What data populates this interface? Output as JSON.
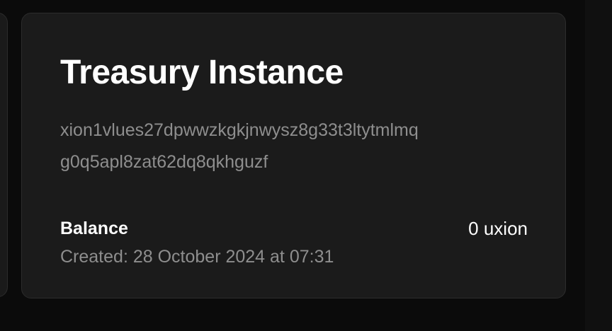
{
  "card": {
    "title": "Treasury Instance",
    "address_line1": "xion1vlues27dpwwzkgkjnwysz8g33t3ltytmlmq",
    "address_line2": "g0q5apl8zat62dq8qkhguzf",
    "balance_label": "Balance",
    "balance_value": "0 uxion",
    "created": "Created: 28 October 2024 at 07:31"
  }
}
